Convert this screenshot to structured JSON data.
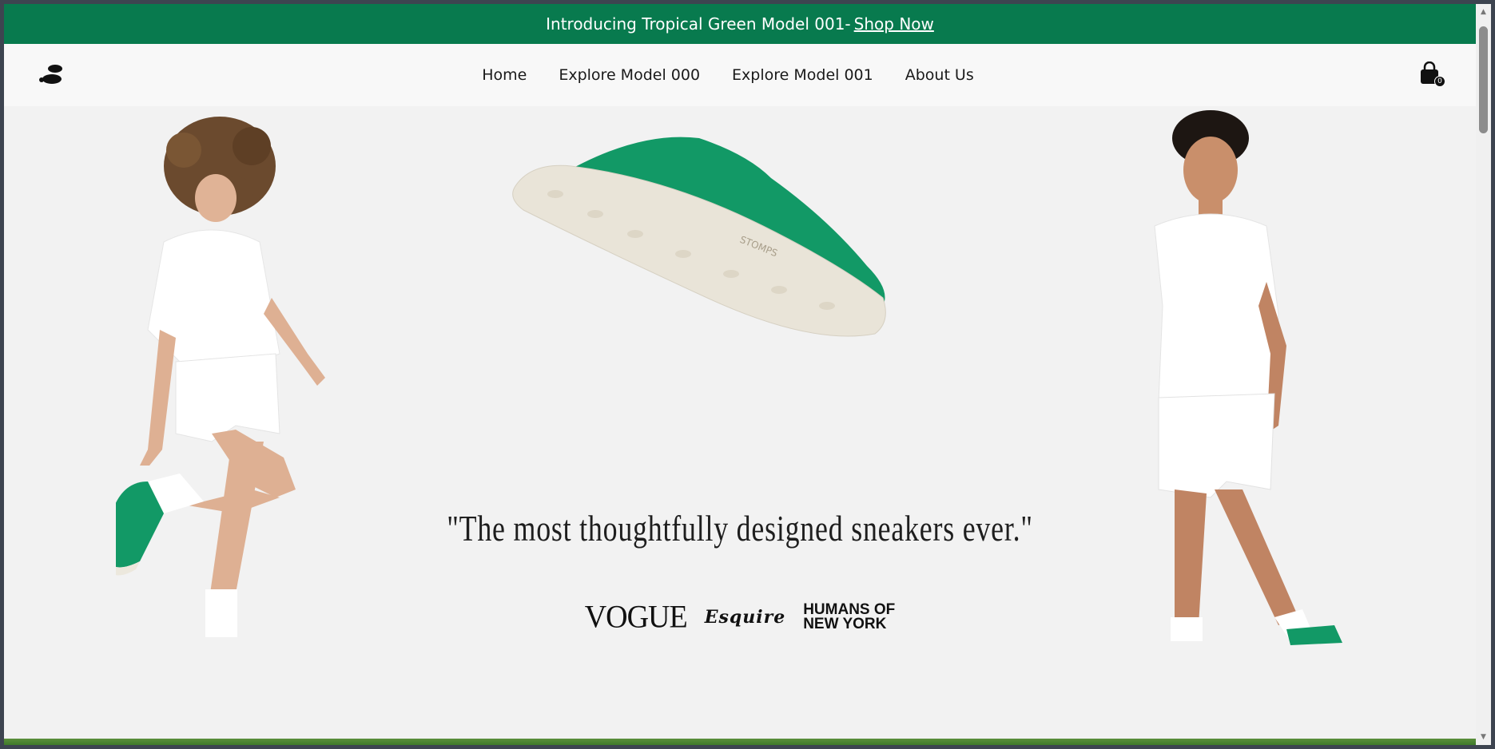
{
  "announcement": {
    "text": "Introducing Tropical Green Model 001-",
    "link": "Shop Now"
  },
  "nav": {
    "items": [
      {
        "label": "Home"
      },
      {
        "label": "Explore Model 000"
      },
      {
        "label": "Explore Model 001"
      },
      {
        "label": "About Us"
      }
    ]
  },
  "cart": {
    "count": "0"
  },
  "hero": {
    "quote": "\"The most thoughtfully designed sneakers ever.\"",
    "press": {
      "vogue": "VOGUE",
      "esquire": "Esquire",
      "hony_line1": "HUMANS OF",
      "hony_line2": "NEW YORK"
    },
    "shoe_brand": "STOMPS"
  },
  "colors": {
    "brand_green": "#087a4e",
    "shoe_green": "#129966",
    "background": "#f2f2f2"
  }
}
